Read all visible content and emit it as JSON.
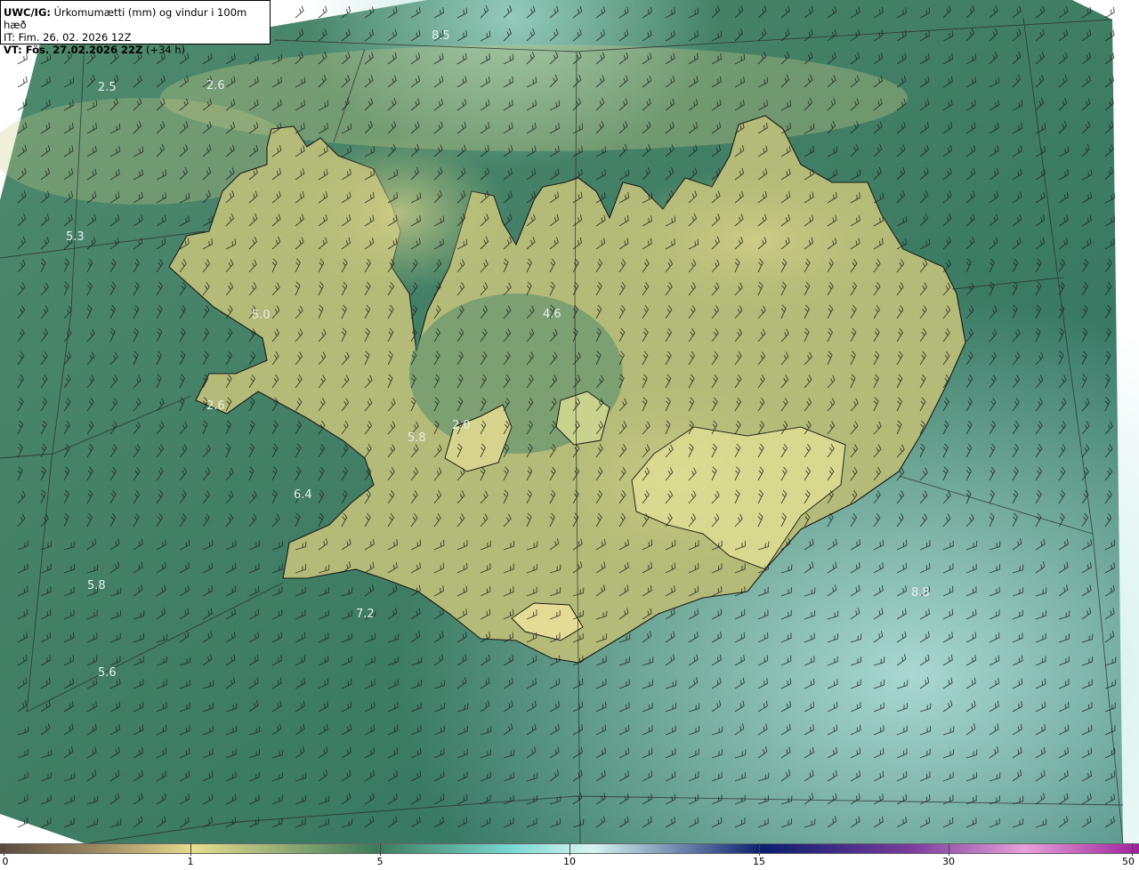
{
  "title": {
    "product": "UWC/IG:",
    "description": "Úrkomumætti (mm) og vindur i 100m hæð",
    "init_time": "IT: Fim. 26. 02. 2026 12Z",
    "valid_label": "VT: Fös. 27.02.2026 22Z",
    "lead": "(+34 h)"
  },
  "map_labels": [
    {
      "id": "l1",
      "text": "8.5"
    },
    {
      "id": "l2",
      "text": "2.5"
    },
    {
      "id": "l3",
      "text": "2.6"
    },
    {
      "id": "l4",
      "text": "5.3"
    },
    {
      "id": "l5",
      "text": "5.0"
    },
    {
      "id": "l6",
      "text": "4.6"
    },
    {
      "id": "l7",
      "text": "2.6"
    },
    {
      "id": "l8",
      "text": "5.8"
    },
    {
      "id": "l9",
      "text": "2.0"
    },
    {
      "id": "l10",
      "text": "6.4"
    },
    {
      "id": "l11",
      "text": "5.8"
    },
    {
      "id": "l12",
      "text": "7.2"
    },
    {
      "id": "l13",
      "text": "5.6"
    },
    {
      "id": "l14",
      "text": "8.8"
    }
  ],
  "colorbar": {
    "ticks": [
      "0",
      "1",
      "5",
      "10",
      "15",
      "30",
      "50"
    ],
    "colors": [
      "#5b4a3c",
      "#a08c64",
      "#e8dc8c",
      "#3c7a5a",
      "#7ad8d4",
      "#d8f4f0",
      "#0a1e6e",
      "#7a3c9e",
      "#e8a0d8",
      "#a0209e"
    ]
  }
}
